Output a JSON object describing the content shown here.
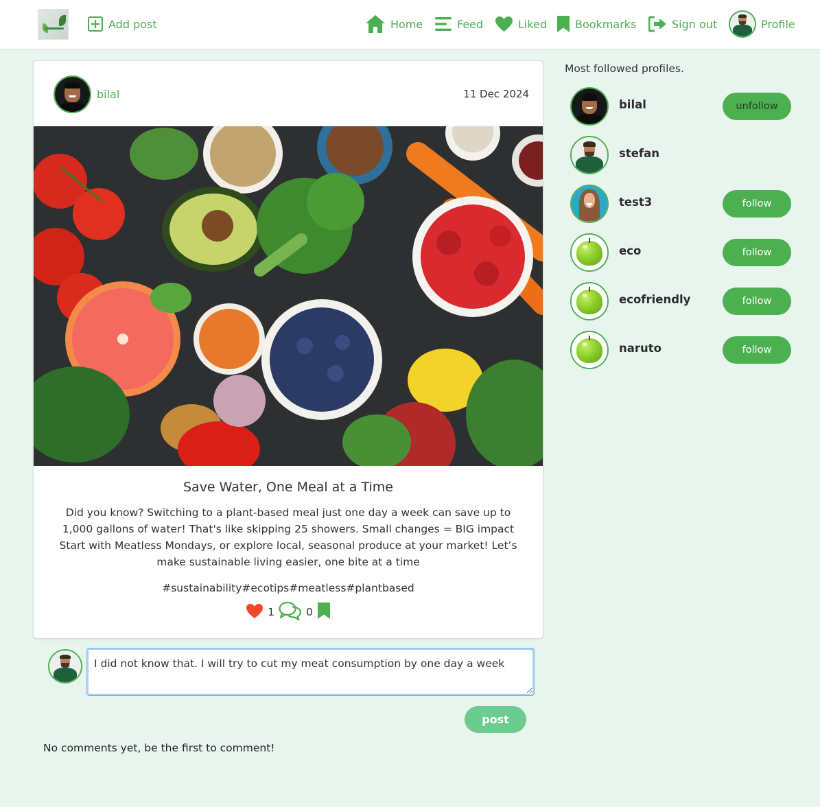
{
  "nav": {
    "add_post": "Add post",
    "home": "Home",
    "feed": "Feed",
    "liked": "Liked",
    "bookmarks": "Bookmarks",
    "sign_out": "Sign out",
    "profile": "Profile"
  },
  "post": {
    "author": "bilal",
    "date": "11 Dec 2024",
    "title": "Save Water, One Meal at a Time",
    "body": "Did you know? Switching to a plant-based meal just one day a week can save up to 1,000 gallons of water! That's like skipping 25 showers. Small changes = BIG impact Start with Meatless Mondays, or explore local, seasonal produce at your market! Let’s make sustainable living easier, one bite at a time",
    "tags": "#sustainability#ecotips#meatless#plantbased",
    "likes": "1",
    "comments": "0"
  },
  "comment_box": {
    "value": "I did not know that. I will try to cut my meat consumption by one day a week",
    "post_label": "post",
    "empty_text": "No comments yet, be the first to comment!"
  },
  "sidebar": {
    "title": "Most followed profiles.",
    "profiles": [
      {
        "name": "bilal",
        "button": "unfollow"
      },
      {
        "name": "stefan",
        "button": ""
      },
      {
        "name": "test3",
        "button": "follow"
      },
      {
        "name": "eco",
        "button": "follow"
      },
      {
        "name": "ecofriendly",
        "button": "follow"
      },
      {
        "name": "naruto",
        "button": "follow"
      }
    ]
  },
  "colors": {
    "brand_green": "#4caf50",
    "page_bg": "#e8f5ee",
    "heart_red": "#f0462a",
    "post_button": "#6ccb8f"
  },
  "icons": {
    "add_post": "plus-square-icon",
    "home": "home-icon",
    "feed": "menu-lines-icon",
    "liked": "heart-icon",
    "bookmarks": "bookmark-icon",
    "sign_out": "sign-out-icon",
    "like_action": "heart-icon",
    "comment_action": "comments-icon",
    "bookmark_action": "bookmark-icon"
  }
}
